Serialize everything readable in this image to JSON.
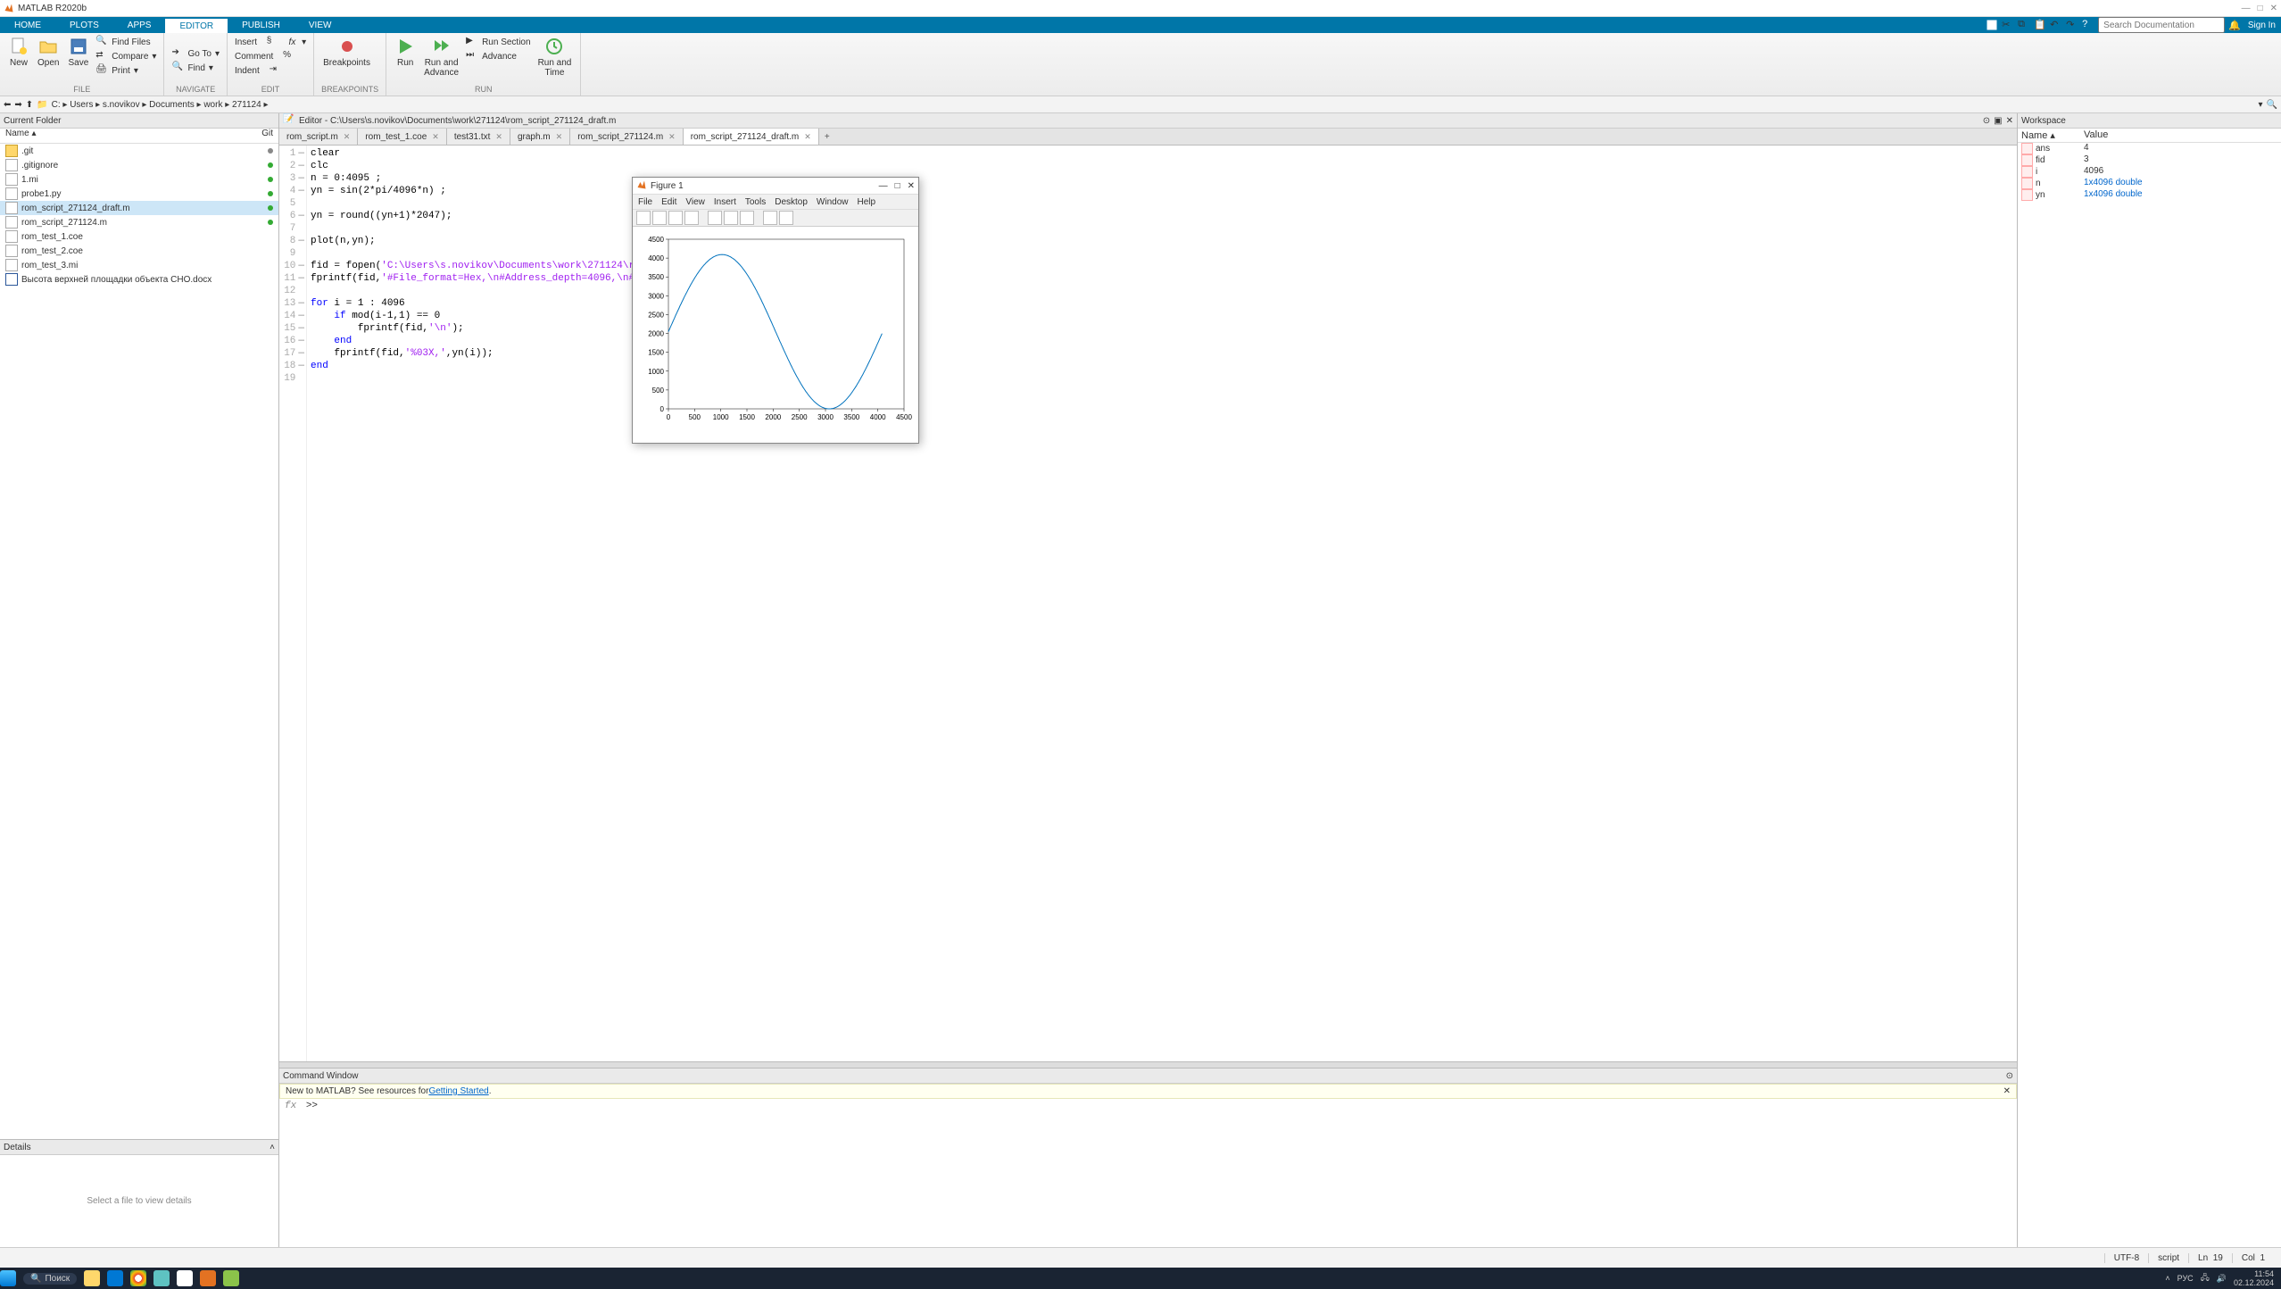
{
  "app": {
    "title": "MATLAB R2020b"
  },
  "win_controls": {
    "min": "—",
    "max": "□",
    "close": "✕"
  },
  "tabs": [
    "HOME",
    "PLOTS",
    "APPS",
    "EDITOR",
    "PUBLISH",
    "VIEW"
  ],
  "active_tab": "EDITOR",
  "search_placeholder": "Search Documentation",
  "signin_label": "Sign In",
  "ribbon": {
    "file": {
      "new": "New",
      "open": "Open",
      "save": "Save",
      "find_files": "Find Files",
      "compare": "Compare",
      "print": "Print",
      "label": "FILE"
    },
    "navigate": {
      "goto": "Go To",
      "find": "Find",
      "label": "NAVIGATE"
    },
    "edit": {
      "insert": "Insert",
      "comment": "Comment",
      "indent": "Indent",
      "fx": "fx",
      "label": "EDIT"
    },
    "breakpoints": {
      "btn": "Breakpoints",
      "label": "BREAKPOINTS"
    },
    "run": {
      "run": "Run",
      "run_and_advance": "Run and\nAdvance",
      "run_section": "Run Section",
      "advance": "Advance",
      "run_and_time": "Run and\nTime",
      "label": "RUN"
    }
  },
  "address": {
    "nodes": [
      "C:",
      "Users",
      "s.novikov",
      "Documents",
      "work",
      "271124"
    ],
    "sep": "▸"
  },
  "current_folder": {
    "title": "Current Folder",
    "col_name": "Name ▴",
    "col_git": "Git",
    "files": [
      {
        "name": ".git",
        "type": "folder",
        "dot": "#888"
      },
      {
        "name": ".gitignore",
        "type": "file",
        "dot": "#3a3"
      },
      {
        "name": "1.mi",
        "type": "file",
        "dot": "#3a3"
      },
      {
        "name": "probe1.py",
        "type": "file",
        "dot": "#3a3"
      },
      {
        "name": "rom_script_271124_draft.m",
        "type": "m",
        "dot": "#3a3",
        "selected": true
      },
      {
        "name": "rom_script_271124.m",
        "type": "m",
        "dot": "#3a3"
      },
      {
        "name": "rom_test_1.coe",
        "type": "file",
        "dot": ""
      },
      {
        "name": "rom_test_2.coe",
        "type": "file",
        "dot": ""
      },
      {
        "name": "rom_test_3.mi",
        "type": "file",
        "dot": ""
      },
      {
        "name": "Высота верхней площадки объекта СНО.docx",
        "type": "word",
        "dot": ""
      }
    ],
    "details_title": "Details",
    "details_body": "Select a file to view details"
  },
  "editor": {
    "panel_title": "Editor - C:\\Users\\s.novikov\\Documents\\work\\271124\\rom_script_271124_draft.m",
    "tabs": [
      "rom_script.m",
      "rom_test_1.coe",
      "test31.txt",
      "graph.m",
      "rom_script_271124.m",
      "rom_script_271124_draft.m"
    ],
    "active_tab": 5,
    "lines": [
      {
        "n": 1,
        "dash": true,
        "html": "clear"
      },
      {
        "n": 2,
        "dash": true,
        "html": "clc"
      },
      {
        "n": 3,
        "dash": true,
        "html": "n = 0:4095 ;"
      },
      {
        "n": 4,
        "dash": true,
        "html": "yn = sin(2*pi/4096*n) ;"
      },
      {
        "n": 5,
        "dash": false,
        "html": ""
      },
      {
        "n": 6,
        "dash": true,
        "html": "yn = round((yn+1)*2047);"
      },
      {
        "n": 7,
        "dash": false,
        "html": ""
      },
      {
        "n": 8,
        "dash": true,
        "html": "plot(n,yn);"
      },
      {
        "n": 9,
        "dash": false,
        "html": ""
      },
      {
        "n": 10,
        "dash": true,
        "html": "fid = fopen(<span class=\"str\">'C:\\Users\\s.novikov\\Documents\\work\\271124\\rom_test_3.mi'</span>,<span class=\"str\">'wt'</span>);"
      },
      {
        "n": 11,
        "dash": true,
        "html": "fprintf(fid,<span class=\"str\">'#File_format=Hex,\\n#Address_depth=4096,\\n#Data_width=12,'</span>);"
      },
      {
        "n": 12,
        "dash": false,
        "html": ""
      },
      {
        "n": 13,
        "dash": true,
        "html": "<span class=\"kw\">for</span> i = 1 : 4096"
      },
      {
        "n": 14,
        "dash": true,
        "html": "    <span class=\"kw\">if</span> mod(i-1,1) == 0"
      },
      {
        "n": 15,
        "dash": true,
        "html": "        fprintf(fid,<span class=\"str\">'\\n'</span>);"
      },
      {
        "n": 16,
        "dash": true,
        "html": "    <span class=\"kw\">end</span>"
      },
      {
        "n": 17,
        "dash": true,
        "html": "    fprintf(fid,<span class=\"str\">'%03X,'</span>,yn(i));"
      },
      {
        "n": 18,
        "dash": true,
        "html": "<span class=\"kw\">end</span>"
      },
      {
        "n": 19,
        "dash": false,
        "html": ""
      }
    ]
  },
  "command_window": {
    "title": "Command Window",
    "banner_prefix": "New to MATLAB? See resources for ",
    "banner_link": "Getting Started",
    "prompt_fx": "fx",
    "prompt": ">>"
  },
  "workspace": {
    "title": "Workspace",
    "col_name": "Name ▴",
    "col_value": "Value",
    "vars": [
      {
        "name": "ans",
        "value": "4",
        "link": false
      },
      {
        "name": "fid",
        "value": "3",
        "link": false
      },
      {
        "name": "i",
        "value": "4096",
        "link": false
      },
      {
        "name": "n",
        "value": "1x4096 double",
        "link": true
      },
      {
        "name": "yn",
        "value": "1x4096 double",
        "link": true
      }
    ]
  },
  "status": {
    "encoding": "UTF-8",
    "mode": "script",
    "ln_label": "Ln",
    "ln": "19",
    "col_label": "Col",
    "col": "1"
  },
  "figure": {
    "title": "Figure 1",
    "menus": [
      "File",
      "Edit",
      "View",
      "Insert",
      "Tools",
      "Desktop",
      "Window",
      "Help"
    ]
  },
  "chart_data": {
    "type": "line",
    "x_range": [
      0,
      4500
    ],
    "y_range": [
      0,
      4500
    ],
    "x_ticks": [
      0,
      500,
      1000,
      1500,
      2000,
      2500,
      3000,
      3500,
      4000,
      4500
    ],
    "y_ticks": [
      0,
      500,
      1000,
      1500,
      2000,
      2500,
      3000,
      3500,
      4000,
      4500
    ],
    "series": [
      {
        "name": "yn",
        "note": "round((sin(2*pi/4096*n)+1)*2047), n=0..4095",
        "values_sample": [
          [
            0,
            2047
          ],
          [
            256,
            2830
          ],
          [
            512,
            3494
          ],
          [
            768,
            3938
          ],
          [
            1024,
            4094
          ],
          [
            1280,
            3938
          ],
          [
            1536,
            3494
          ],
          [
            1792,
            2830
          ],
          [
            2048,
            2047
          ],
          [
            2304,
            1264
          ],
          [
            2560,
            600
          ],
          [
            2816,
            156
          ],
          [
            3072,
            0
          ],
          [
            3328,
            156
          ],
          [
            3584,
            600
          ],
          [
            3840,
            1264
          ],
          [
            4095,
            2044
          ]
        ]
      }
    ]
  },
  "taskbar": {
    "search_placeholder": "Поиск",
    "tray": {
      "lang": "РУС",
      "time": "11:54",
      "date": "02.12.2024"
    }
  }
}
